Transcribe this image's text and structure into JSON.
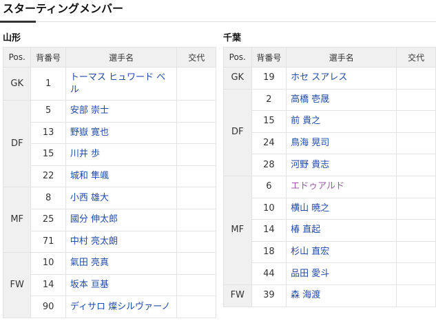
{
  "section_title": "スターティングメンバー",
  "headers": {
    "pos": "Pos.",
    "num": "背番号",
    "player": "選手名",
    "sub": "交代"
  },
  "teams": [
    {
      "name": "山形",
      "groups": [
        {
          "pos": "GK",
          "players": [
            {
              "num": "1",
              "name": "トーマス ヒュワード ベル"
            }
          ]
        },
        {
          "pos": "DF",
          "players": [
            {
              "num": "5",
              "name": "安部 崇士"
            },
            {
              "num": "13",
              "name": "野嶽 寛也"
            },
            {
              "num": "15",
              "name": "川井 歩"
            },
            {
              "num": "22",
              "name": "城和 隼颯"
            }
          ]
        },
        {
          "pos": "MF",
          "players": [
            {
              "num": "8",
              "name": "小西 雄大"
            },
            {
              "num": "25",
              "name": "國分 伸太郎"
            },
            {
              "num": "71",
              "name": "中村 亮太朗"
            }
          ]
        },
        {
          "pos": "FW",
          "players": [
            {
              "num": "10",
              "name": "氣田 亮真"
            },
            {
              "num": "14",
              "name": "坂本 亘基"
            },
            {
              "num": "90",
              "name": "ディサロ 燦シルヴァーノ"
            }
          ]
        }
      ]
    },
    {
      "name": "千葉",
      "groups": [
        {
          "pos": "GK",
          "players": [
            {
              "num": "19",
              "name": "ホセ スアレス"
            }
          ]
        },
        {
          "pos": "DF",
          "players": [
            {
              "num": "2",
              "name": "高橋 壱晟"
            },
            {
              "num": "15",
              "name": "前 貴之"
            },
            {
              "num": "24",
              "name": "鳥海 晃司"
            },
            {
              "num": "28",
              "name": "河野 貴志"
            }
          ]
        },
        {
          "pos": "MF",
          "players": [
            {
              "num": "6",
              "name": "エドゥアルド"
            },
            {
              "num": "10",
              "name": "横山 暁之"
            },
            {
              "num": "14",
              "name": "椿 直起"
            },
            {
              "num": "18",
              "name": "杉山 直宏"
            },
            {
              "num": "44",
              "name": "品田 愛斗"
            }
          ]
        },
        {
          "pos": "FW",
          "players": [
            {
              "num": "39",
              "name": "森 海渡"
            }
          ]
        }
      ]
    }
  ],
  "colors": {
    "link": "#1f4aa8",
    "visited_link": "#9a5aa6",
    "header_bg": "#f0f0f0",
    "border": "#e3e3e3"
  }
}
